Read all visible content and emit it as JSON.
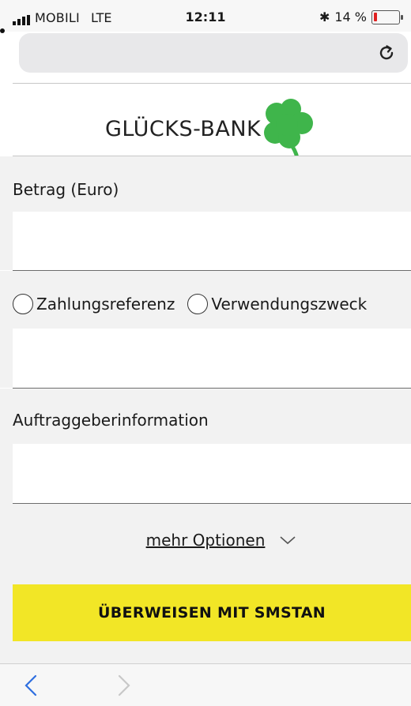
{
  "status": {
    "carrier": "MOBILI",
    "network": "LTE",
    "time": "12:11",
    "battery_text": "14 %",
    "battery_level": 0.14
  },
  "bank": {
    "name": "GLÜCKS-BANK"
  },
  "form": {
    "amount_label": "Betrag (Euro)",
    "amount_value": "",
    "reference_option": "Zahlungsreferenz",
    "purpose_option": "Verwendungszweck",
    "reference_value": "",
    "sender_label": "Auftraggeberinformation",
    "sender_value": "",
    "more_options": "mehr Optionen",
    "submit_label": "ÜBERWEISEN MIT SMSTAN"
  },
  "colors": {
    "accent": "#f2e626",
    "clover": "#3fb54b",
    "battery_low": "#e02020"
  },
  "icons": {
    "reload": "reload-icon",
    "back": "back-arrow-icon",
    "forward": "forward-arrow-icon",
    "clover": "clover-logo",
    "chevron": "chevron-down-icon"
  }
}
